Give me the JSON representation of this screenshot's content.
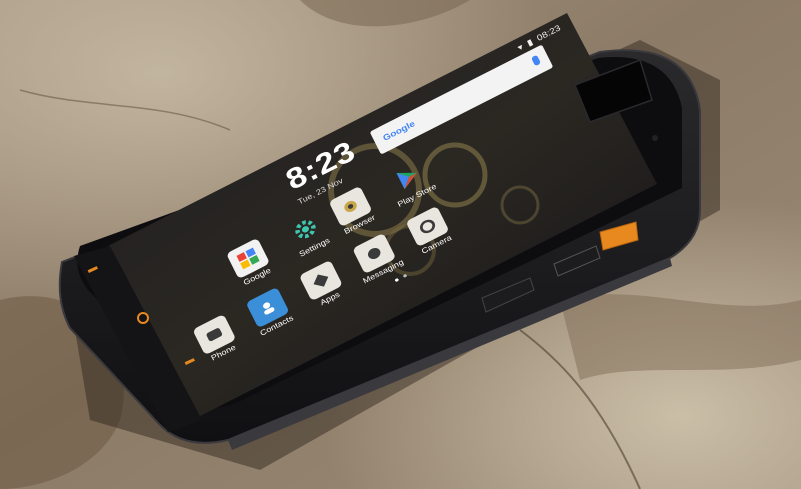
{
  "scene": {
    "colors": {
      "rock_base": "#8b7a66",
      "rock_light": "#b8a88f",
      "rock_dark": "#5a4a38",
      "phone_body": "#1b1b1d",
      "phone_edge": "#2e2e31",
      "screen_bg": "#16151a",
      "orange_accent": "#e8891f"
    },
    "status_bar": {
      "time": "08:23"
    },
    "clock": {
      "time": "8:23",
      "date": "Tue, 23 Nov"
    },
    "search": {
      "logo_text": "Google"
    },
    "apps": [
      {
        "label": "Google",
        "icon": "google-folder-icon",
        "color": "#ffffff"
      },
      {
        "label": "Settings",
        "icon": "gear-icon",
        "color": "#3ec7b0"
      },
      {
        "label": "Phone",
        "icon": "phone-icon",
        "color": "#e9e6df"
      },
      {
        "label": "Contacts",
        "icon": "contacts-icon",
        "color": "#3b8ed8"
      },
      {
        "label": "Apps",
        "icon": "apps-grid-icon",
        "color": "#e9e6df"
      },
      {
        "label": "Messaging",
        "icon": "message-icon",
        "color": "#e9e6df"
      },
      {
        "label": "Camera",
        "icon": "camera-icon",
        "color": "#e9e6df"
      },
      {
        "label": "Browser",
        "icon": "browser-icon",
        "color": "#e9e6df"
      },
      {
        "label": "Play Store",
        "icon": "play-store-icon",
        "color": "#1ea362"
      }
    ]
  }
}
